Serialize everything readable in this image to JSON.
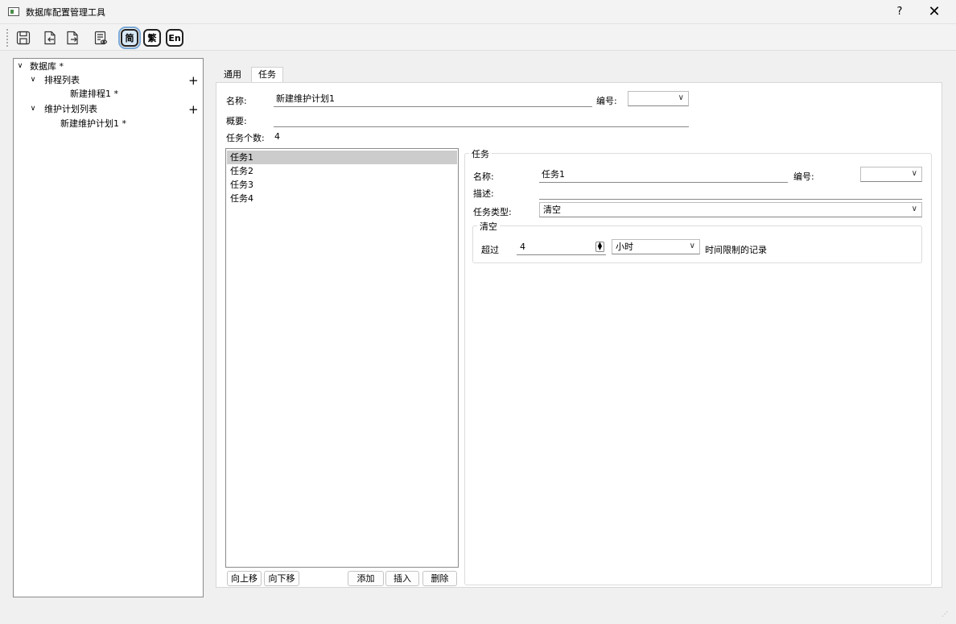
{
  "window": {
    "title": "数据库配置管理工具",
    "help_label": "?",
    "close_label": "✕"
  },
  "toolbar": {
    "icons": [
      "save-icon",
      "import-icon",
      "export-icon",
      "preview-icon"
    ],
    "lang_simplified": "简",
    "lang_traditional": "繁",
    "lang_english": "En"
  },
  "tree": {
    "root": "数据库 *",
    "schedule_list": "排程列表",
    "schedule_item": "新建排程1 *",
    "maint_list": "维护计划列表",
    "maint_item": "新建维护计划1 *",
    "add_label": "+"
  },
  "tabs": {
    "general": "通用",
    "task": "任务"
  },
  "plan": {
    "name_label": "名称:",
    "name_value": "新建维护计划1",
    "number_label": "编号:",
    "number_value": "",
    "summary_label": "概要:",
    "summary_value": "",
    "task_count_label": "任务个数:",
    "task_count_value": "4"
  },
  "task_list": {
    "items": [
      "任务1",
      "任务2",
      "任务3",
      "任务4"
    ],
    "selected_index": 0,
    "btn_move_up": "向上移",
    "btn_move_down": "向下移",
    "btn_add": "添加",
    "btn_insert": "插入",
    "btn_delete": "删除"
  },
  "task_detail": {
    "group_title": "任务",
    "name_label": "名称:",
    "name_value": "任务1",
    "number_label": "编号:",
    "number_value": "",
    "desc_label": "描述:",
    "desc_value": "",
    "type_label": "任务类型:",
    "type_value": "清空",
    "clear_group_title": "清空",
    "exceed_label": "超过",
    "exceed_value": "4",
    "unit_value": "小时",
    "suffix_label": "时间限制的记录"
  }
}
